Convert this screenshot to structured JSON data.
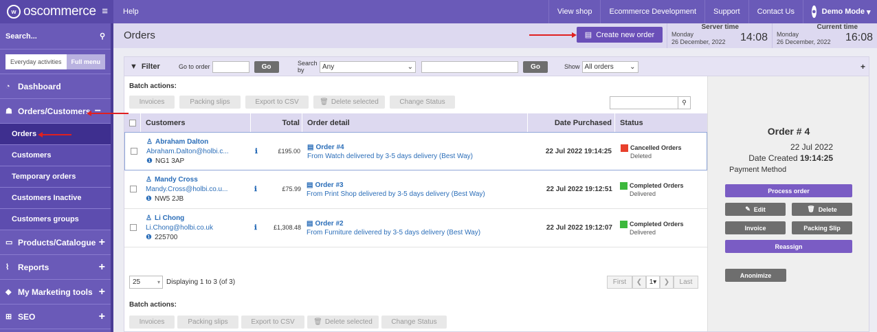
{
  "header": {
    "logo_text": "oscommerce",
    "help": "Help",
    "nav": [
      "View shop",
      "Ecommerce Development",
      "Support",
      "Contact Us"
    ],
    "user": "Demo Mode"
  },
  "sidebar": {
    "search_label": "Search...",
    "modes": [
      "Everyday activities",
      "Full menu"
    ],
    "items": [
      {
        "label": "Dashboard",
        "icon": "dashboard-icon"
      },
      {
        "label": "Orders/Customers",
        "icon": "users-icon",
        "toggle": "−"
      },
      {
        "label": "Products/Catalogue",
        "icon": "folder-icon",
        "toggle": "+"
      },
      {
        "label": "Reports",
        "icon": "chart-icon",
        "toggle": "+"
      },
      {
        "label": "My Marketing tools",
        "icon": "tag-icon",
        "toggle": "+"
      },
      {
        "label": "SEO",
        "icon": "sitemap-icon",
        "toggle": "+"
      }
    ],
    "subitems": [
      "Orders",
      "Customers",
      "Temporary orders",
      "Customers Inactive",
      "Customers groups"
    ]
  },
  "titlebar": {
    "title": "Orders",
    "create_label": "Create new order",
    "server_label": "Server time",
    "server_day": "Monday",
    "server_date": "26 December, 2022",
    "server_time": "14:08",
    "current_label": "Current time",
    "current_day": "Monday",
    "current_date": "26 December, 2022",
    "current_time": "16:08"
  },
  "filter": {
    "label": "Filter",
    "goto_label": "Go to order",
    "go": "Go",
    "search_by_label": "Search by",
    "search_by_value": "Any",
    "show_label": "Show",
    "show_value": "All orders",
    "plus": "+"
  },
  "batch": {
    "label": "Batch actions:",
    "buttons": [
      "Invoices",
      "Packing slips",
      "Export to CSV",
      "Delete selected",
      "Change Status"
    ]
  },
  "table": {
    "headers": [
      "Customers",
      "Total",
      "Order detail",
      "Date Purchased",
      "Status"
    ],
    "rows": [
      {
        "name": "Abraham Dalton",
        "email": "Abraham.Dalton@holbi.c...",
        "postcode": "NG1 3AP",
        "total": "£195.00",
        "order": "Order #4",
        "detail": "From Watch delivered by 3-5 days delivery (Best Way)",
        "date": "22 Jul 2022 19:14:25",
        "status": "Cancelled Orders",
        "substatus": "Deleted",
        "status_color": "#e8402c"
      },
      {
        "name": "Mandy Cross",
        "email": "Mandy.Cross@holbi.co.u...",
        "postcode": "NW5 2JB",
        "total": "£75.99",
        "order": "Order #3",
        "detail": "From Print Shop delivered by 3-5 days delivery (Best Way)",
        "date": "22 Jul 2022 19:12:51",
        "status": "Completed Orders",
        "substatus": "Delivered",
        "status_color": "#3cb83c"
      },
      {
        "name": "Li Chong",
        "email": "Li.Chong@holbi.co.uk",
        "postcode": "225700",
        "total": "£1,308.48",
        "order": "Order #2",
        "detail": "From Furniture delivered by 3-5 days delivery (Best Way)",
        "date": "22 Jul 2022 19:12:07",
        "status": "Completed Orders",
        "substatus": "Delivered",
        "status_color": "#3cb83c"
      }
    ]
  },
  "pager": {
    "per_page": "25",
    "info": "Displaying 1 to 3 (of 3)",
    "first": "First",
    "prev": "❮",
    "page": "1",
    "next": "❯",
    "last": "Last"
  },
  "detail": {
    "title": "Order # 4",
    "date": "22 Jul 2022",
    "created_label": "Date Created",
    "created_time": "19:14:25",
    "payment_label": "Payment Method",
    "process": "Process order",
    "edit": "Edit",
    "delete": "Delete",
    "invoice": "Invoice",
    "packing": "Packing Slip",
    "reassign": "Reassign",
    "anonimize": "Anonimize"
  },
  "colors": {
    "brand": "#6a5ab8",
    "annotation_arrow": "#e02020"
  }
}
